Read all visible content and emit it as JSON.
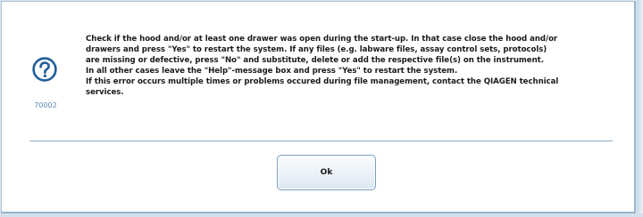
{
  "dialog": {
    "icon": "question-mark-icon",
    "message_code": "70002",
    "message_lines": [
      "Check if the hood and/or at least one drawer was open during the start-up. In that case close the hood and/or",
      "drawers and press \"Yes\" to restart the system. If any files (e.g. labware files, assay control sets, protocols)",
      "are missing or defective, press \"No\" and substitute, delete or add the respective file(s) on the instrument.",
      "In all other cases leave the \"Help\"-message box and press \"Yes\" to restart the system.",
      "If this error occurs multiple times or problems occured during file management, contact the QIAGEN technical",
      "services."
    ],
    "ok_label": "Ok"
  },
  "colors": {
    "background": "#dbe7f2",
    "dialog_bg": "#ffffff",
    "icon_blue": "#1f5e9c",
    "code_text": "#5b86ac",
    "separator": "#8eaecc",
    "button_border": "#7e9fbe"
  }
}
